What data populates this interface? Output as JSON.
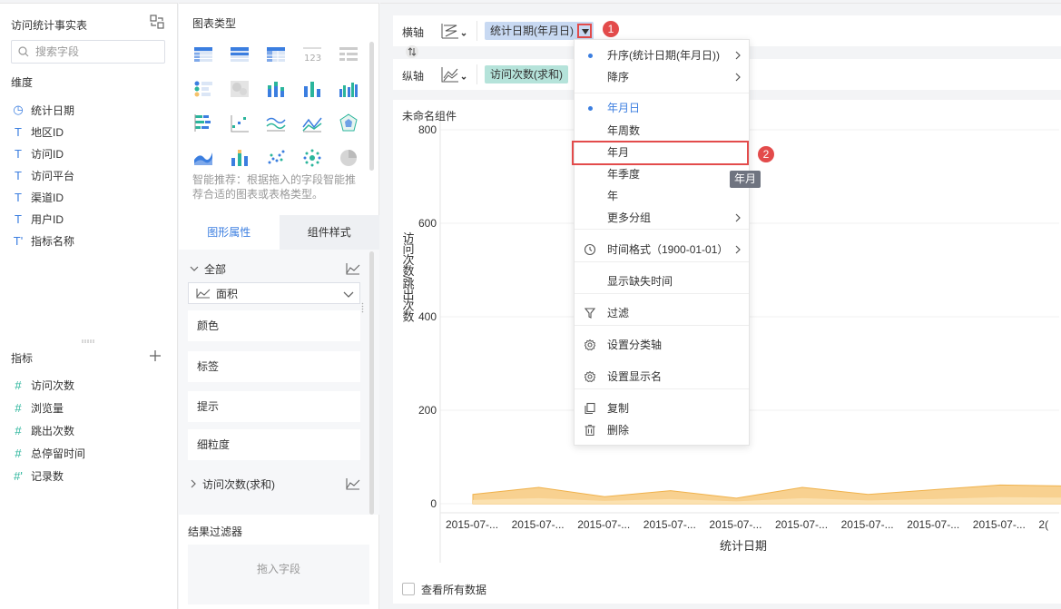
{
  "left_panel": {
    "table_name": "访问统计事实表",
    "search_placeholder": "搜索字段",
    "dimensions_title": "维度",
    "dimensions": [
      {
        "icon": "clock-icon",
        "glyph": "◷",
        "label": "统计日期"
      },
      {
        "icon": "text-type-icon",
        "glyph": "T",
        "label": "地区ID"
      },
      {
        "icon": "text-type-icon",
        "glyph": "T",
        "label": "访问ID"
      },
      {
        "icon": "text-type-icon",
        "glyph": "T",
        "label": "访问平台"
      },
      {
        "icon": "text-type-icon",
        "glyph": "T",
        "label": "渠道ID"
      },
      {
        "icon": "text-type-icon",
        "glyph": "T",
        "label": "用户ID"
      },
      {
        "icon": "text-calc-icon",
        "glyph": "T'",
        "label": "指标名称"
      }
    ],
    "measures_title": "指标",
    "measures": [
      {
        "icon": "number-type-icon",
        "glyph": "#",
        "label": "访问次数"
      },
      {
        "icon": "number-type-icon",
        "glyph": "#",
        "label": "浏览量"
      },
      {
        "icon": "number-type-icon",
        "glyph": "#",
        "label": "跳出次数"
      },
      {
        "icon": "number-type-icon",
        "glyph": "#",
        "label": "总停留时间"
      },
      {
        "icon": "number-calc-icon",
        "glyph": "#'",
        "label": "记录数"
      }
    ]
  },
  "middle_panel": {
    "chart_type_title": "图表类型",
    "smart_tip": "智能推荐：根据拖入的字段智能推荐合适的图表或表格类型。",
    "tabs": [
      {
        "label": "图形属性",
        "active": true
      },
      {
        "label": "组件样式",
        "active": false
      }
    ],
    "all_label": "全部",
    "chart_select_value": "面积",
    "properties": [
      "颜色",
      "标签",
      "提示",
      "细粒度"
    ],
    "measure_group": "访问次数(求和)",
    "result_filter_title": "结果过滤器",
    "drop_hint": "拖入字段"
  },
  "axes": {
    "x_label": "横轴",
    "x_field": "统计日期(年月日)",
    "y_label": "纵轴",
    "y_field": "访问次数(求和)"
  },
  "chart_card": {
    "component_title": "未命名组件",
    "show_all_data": "查看所有数据"
  },
  "chart_data": {
    "type": "area",
    "ylabel": "访问次数/跳出次数",
    "xlabel": "统计日期",
    "ylim": [
      0,
      800
    ],
    "yticks": [
      0,
      200,
      400,
      600,
      800
    ],
    "categories": [
      "2015-07-...",
      "2015-07-...",
      "2015-07-...",
      "2015-07-...",
      "2015-07-...",
      "2015-07-...",
      "2015-07-...",
      "2015-07-...",
      "2015-07-...",
      "2("
    ],
    "series": [
      {
        "values": [
          20,
          35,
          15,
          28,
          12,
          35,
          20,
          30,
          40,
          38
        ],
        "color": "#f5c26b"
      },
      {
        "values": [
          8,
          12,
          6,
          10,
          5,
          12,
          7,
          10,
          14,
          13
        ],
        "color": "#fbe2b4"
      }
    ]
  },
  "dropdown_menu": {
    "items": [
      {
        "label": "升序(统计日期(年月日))",
        "dot": true,
        "submenu": true
      },
      {
        "label": "降序",
        "dot": false,
        "submenu": true
      },
      {
        "label": "年月日",
        "dot": true,
        "selected": true,
        "submenu": false
      },
      {
        "label": "年周数",
        "dot": false,
        "submenu": false
      },
      {
        "label": "年月",
        "dot": false,
        "submenu": false
      },
      {
        "label": "年季度",
        "dot": false,
        "submenu": false
      },
      {
        "label": "年",
        "dot": false,
        "submenu": false
      },
      {
        "label": "更多分组",
        "dot": false,
        "submenu": true
      },
      {
        "label": "时间格式（1900-01-01）",
        "icon": "clock-icon",
        "submenu": true
      },
      {
        "label": "显示缺失时间",
        "submenu": false
      },
      {
        "label": "过滤",
        "icon": "filter-icon",
        "submenu": false
      },
      {
        "label": "设置分类轴",
        "icon": "gear-icon",
        "submenu": false
      },
      {
        "label": "设置显示名",
        "icon": "gear-icon",
        "submenu": false
      },
      {
        "label": "复制",
        "icon": "copy-icon",
        "submenu": false
      },
      {
        "label": "删除",
        "icon": "trash-icon",
        "submenu": false
      }
    ],
    "tooltip": "年月"
  },
  "annotations": {
    "badge1": "1",
    "badge2": "2"
  },
  "colors": {
    "accent": "#3b7ee0",
    "highlight_red": "#e34b4b",
    "x_pill": "#c8d9f2",
    "y_pill": "#b5e3da"
  }
}
